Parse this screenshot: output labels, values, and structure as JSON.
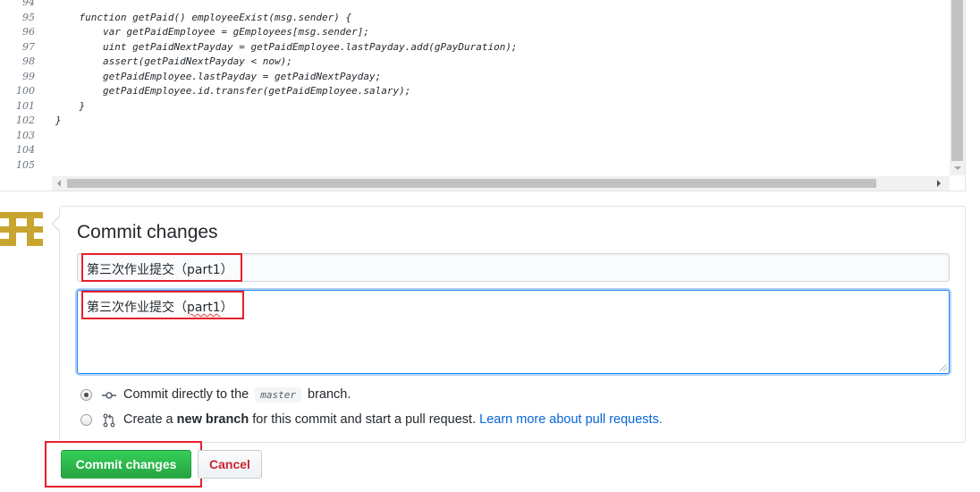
{
  "editor": {
    "line_numbers": [
      "94",
      "95",
      "96",
      "97",
      "98",
      "99",
      "100",
      "101",
      "102",
      "103",
      "104",
      "105"
    ],
    "lines": [
      "",
      "    function getPaid() employeeExist(msg.sender) {",
      "        var getPaidEmployee = gEmployees[msg.sender];",
      "        uint getPaidNextPayday = getPaidEmployee.lastPayday.add(gPayDuration);",
      "        assert(getPaidNextPayday < now);",
      "        getPaidEmployee.lastPayday = getPaidNextPayday;",
      "        getPaidEmployee.id.transfer(getPaidEmployee.salary);",
      "    }",
      "}",
      "",
      "",
      ""
    ]
  },
  "commit": {
    "title": "Commit changes",
    "summary_value": "第三次作业提交（part1）",
    "description_prefix": "第三次作业提交（",
    "description_word": "part1",
    "description_suffix": "）",
    "options": {
      "direct_before": "Commit directly to the",
      "branch_name": "master",
      "direct_after": "branch.",
      "new_prefix": "Create a",
      "new_bold": "new branch",
      "new_mid": "for this commit and start a pull request.",
      "new_link": "Learn more about pull requests."
    },
    "commit_button": "Commit changes",
    "cancel_button": "Cancel"
  },
  "colors": {
    "primary_button": "#28a745",
    "cancel_text": "#cb2431",
    "link": "#0366d6",
    "annotation_box": "#e8202a",
    "focus_border": "#2188ff"
  }
}
